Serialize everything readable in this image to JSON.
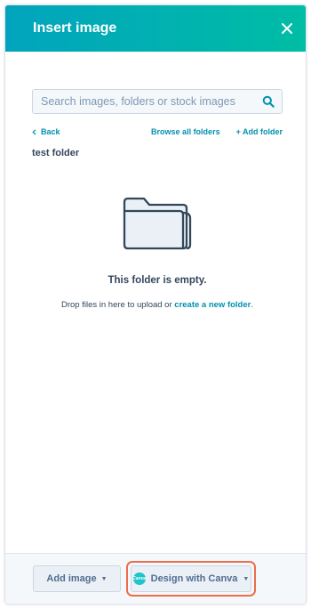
{
  "dialog": {
    "title": "Insert image",
    "close_icon": "close-icon"
  },
  "search": {
    "placeholder": "Search images, folders or stock images",
    "icon": "search-icon"
  },
  "nav": {
    "back_label": "Back",
    "browse_label": "Browse all folders",
    "add_folder_label": "+ Add folder"
  },
  "folder": {
    "name": "test folder"
  },
  "empty_state": {
    "icon": "folder-icon",
    "title": "This folder is empty.",
    "text_before": "Drop files in here to upload or ",
    "link": "create a new folder",
    "text_after": "."
  },
  "footer": {
    "add_image_label": "Add image",
    "design_canva_label": "Design with Canva",
    "canva_logo_text": "Canva"
  },
  "colors": {
    "header_start": "#01a4bd",
    "header_end": "#00bda5",
    "link": "#0091ae",
    "highlight": "#ec6d4b",
    "canva": "#20c4cb"
  }
}
